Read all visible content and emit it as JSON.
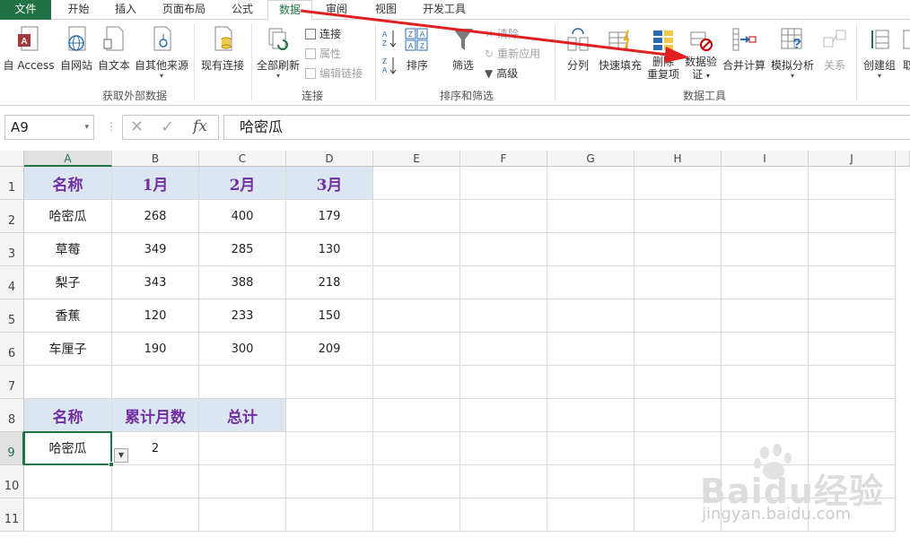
{
  "tabs": [
    "文件",
    "开始",
    "插入",
    "页面布局",
    "公式",
    "数据",
    "审阅",
    "视图",
    "开发工具"
  ],
  "active_tab": "数据",
  "ribbon": {
    "get_external": {
      "buttons": [
        "自 Access",
        "自网站",
        "自文本",
        "自其他来源",
        "现有连接"
      ],
      "label": "获取外部数据"
    },
    "connections": {
      "refresh_all": "全部刷新",
      "connections": "连接",
      "properties": "属性",
      "edit_links": "编辑链接",
      "label": "连接"
    },
    "sort_filter": {
      "sort": "排序",
      "filter": "筛选",
      "clear": "清除",
      "reapply": "重新应用",
      "advanced": "高级",
      "label": "排序和筛选",
      "az": "A\nZ",
      "za": "Z\nA"
    },
    "data_tools": {
      "text_to_columns": "分列",
      "flash_fill": "快速填充",
      "remove_duplicates_1": "删除",
      "remove_duplicates_2": "重复项",
      "data_validation_1": "数据验",
      "data_validation_2": "证",
      "consolidate": "合并计算",
      "what_if": "模拟分析",
      "relationships": "关系",
      "label": "数据工具"
    },
    "outline": {
      "group": "创建组",
      "ungroup": "取"
    }
  },
  "formula_bar": {
    "name_box": "A9",
    "content": "哈密瓜",
    "fx": "fx"
  },
  "columns": [
    "A",
    "B",
    "C",
    "D",
    "E",
    "F",
    "G",
    "H",
    "I",
    "J"
  ],
  "rows": [
    "1",
    "2",
    "3",
    "4",
    "5",
    "6",
    "7",
    "8",
    "9",
    "10",
    "11"
  ],
  "table1": {
    "headers": [
      "名称",
      "1月",
      "2月",
      "3月"
    ],
    "rows": [
      [
        "哈密瓜",
        "268",
        "400",
        "179"
      ],
      [
        "草莓",
        "349",
        "285",
        "130"
      ],
      [
        "梨子",
        "343",
        "388",
        "218"
      ],
      [
        "香蕉",
        "120",
        "233",
        "150"
      ],
      [
        "车厘子",
        "190",
        "300",
        "209"
      ]
    ]
  },
  "table2": {
    "headers": [
      "名称",
      "累计月数",
      "总计"
    ],
    "row": [
      "哈密瓜",
      "2",
      ""
    ]
  },
  "colors": {
    "excel_green": "#217346",
    "header_fill": "#dce6f1",
    "header_text": "#7030a0",
    "arrow_red": "#e02020"
  },
  "watermark": {
    "brand": "Baidu经验",
    "url": "jingyan.baidu.com"
  }
}
